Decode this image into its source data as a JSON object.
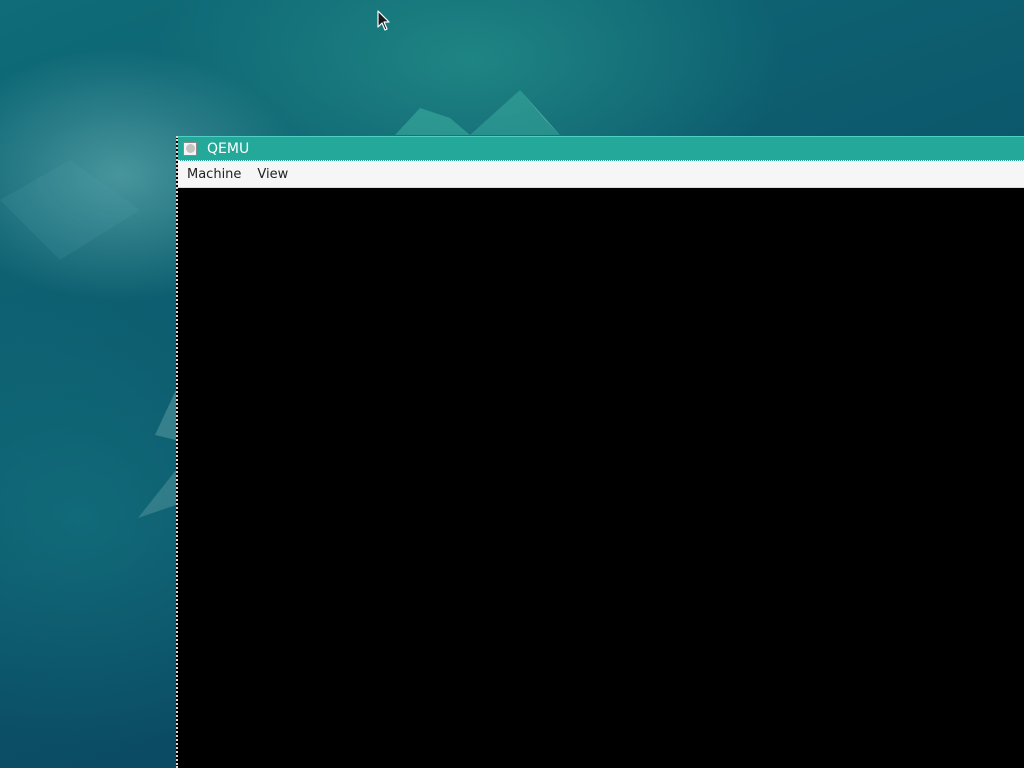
{
  "window": {
    "title": "QEMU",
    "icon": "qemu-app-icon"
  },
  "menubar": {
    "items": [
      {
        "label": "Machine"
      },
      {
        "label": "View"
      }
    ]
  },
  "colors": {
    "titlebar": "#23a89a",
    "desktop": "#0b4f66",
    "guest_screen": "#000000",
    "menubar": "#f6f6f6"
  },
  "icons": {
    "cursor": "mouse-pointer-icon"
  }
}
